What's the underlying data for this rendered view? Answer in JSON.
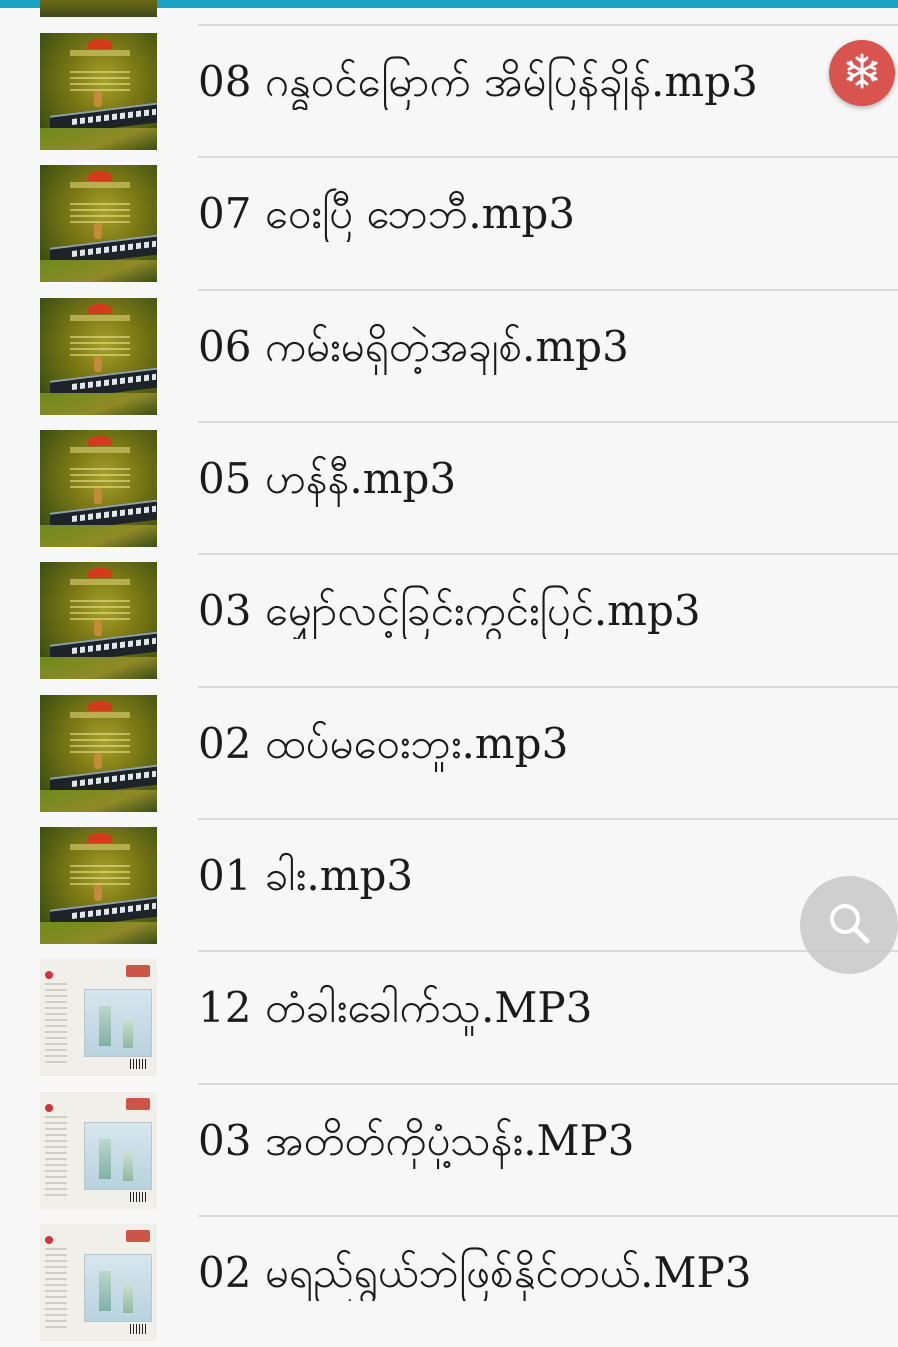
{
  "app": {
    "accent_color": "#1aa3c4"
  },
  "tracks": [
    {
      "title": "08 ဂန္ဓဝင်မြောက် အိမ်ပြန်ချိန်.mp3",
      "thumb": "unplugged"
    },
    {
      "title": "07 ဝေးပြီ ဘေဘီ.mp3",
      "thumb": "unplugged"
    },
    {
      "title": "06 ကမ်းမရှိတဲ့အချစ်.mp3",
      "thumb": "unplugged"
    },
    {
      "title": "05 ဟန်နီ.mp3",
      "thumb": "unplugged"
    },
    {
      "title": "03 မျှော်လင့်ခြင်းကွင်းပြင်.mp3",
      "thumb": "unplugged"
    },
    {
      "title": "02 ထပ်မဝေးဘူး.mp3",
      "thumb": "unplugged"
    },
    {
      "title": "01 ခါး.mp3",
      "thumb": "unplugged"
    },
    {
      "title": "12 တံခါးခေါက်သူ.MP3",
      "thumb": "cover2"
    },
    {
      "title": "03 အတိတ်ကိုပုံ့သန်း.MP3",
      "thumb": "cover2"
    },
    {
      "title": "02 မရည်ရွယ်ဘဲဖြစ်နိုင်တယ်.MP3",
      "thumb": "cover2"
    }
  ],
  "buttons": {
    "snow_icon": "snowflake-icon",
    "search_icon": "search-icon",
    "snow_color": "#d9534f"
  }
}
